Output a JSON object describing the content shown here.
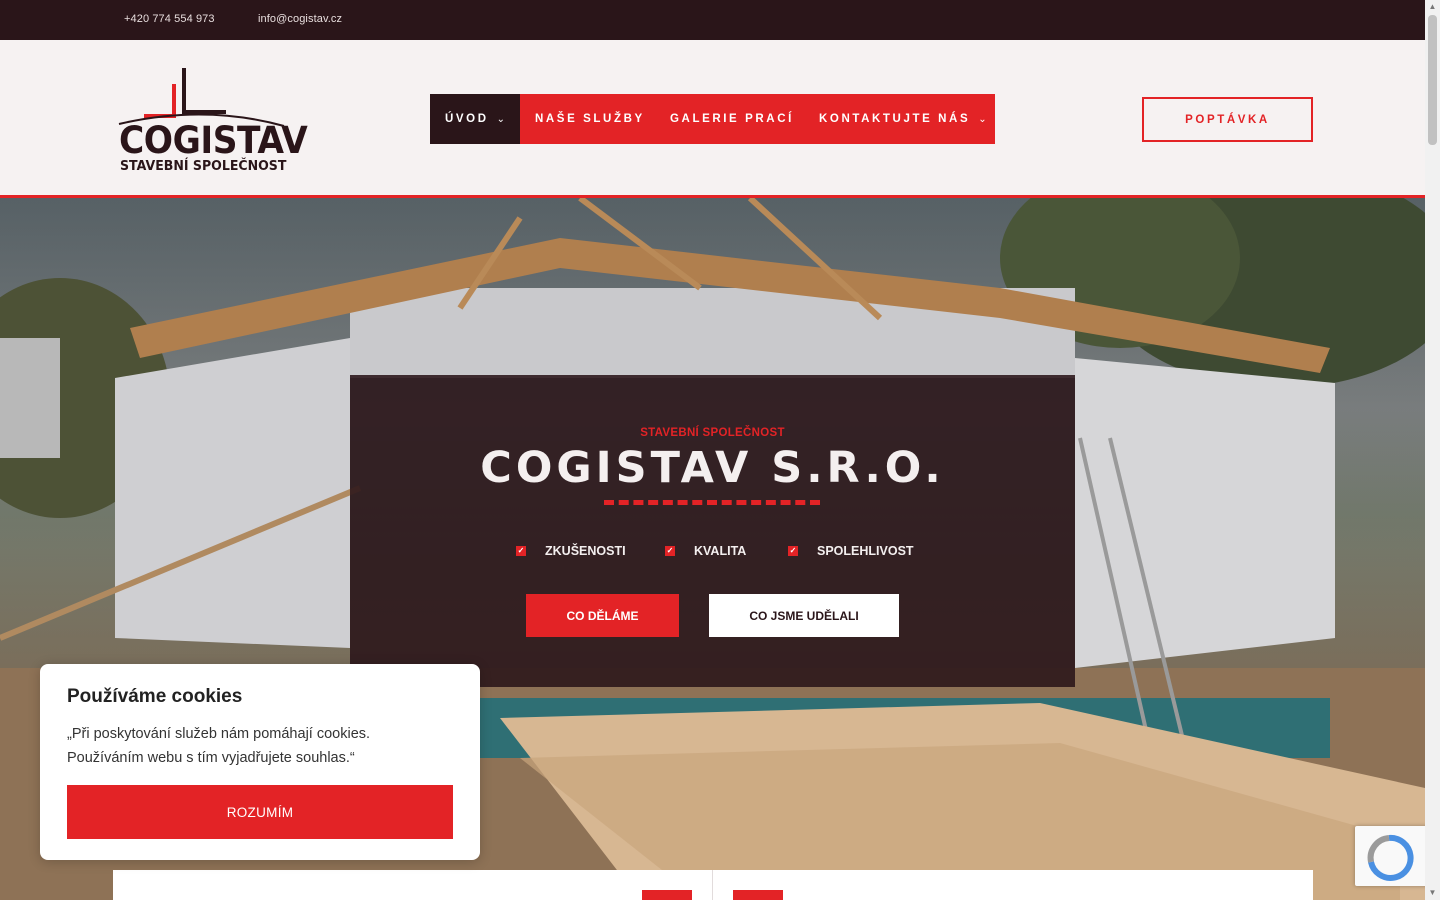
{
  "topbar": {
    "phone": "+420 774 554 973",
    "email": "info@cogistav.cz"
  },
  "brand": {
    "name": "COGISTAV",
    "tagline": "STAVEBNÍ SPOLEČNOST",
    "accent": "#e32326",
    "dark": "#2a1519"
  },
  "nav": {
    "items": [
      {
        "label": "ÚVOD",
        "has_dropdown": true,
        "active": true
      },
      {
        "label": "NAŠE SLUŽBY",
        "has_dropdown": false
      },
      {
        "label": "GALERIE PRACÍ",
        "has_dropdown": false
      },
      {
        "label": "KONTAKTUJTE NÁS",
        "has_dropdown": true
      }
    ],
    "chevron_icon": "chevron-down-icon"
  },
  "cta": {
    "poptavka": "POPTÁVKA"
  },
  "hero": {
    "kicker": "STAVEBNÍ SPOLEČNOST",
    "title": "COGISTAV S.R.O.",
    "features": [
      "ZKUŠENOSTI",
      "KVALITA",
      "SPOLEHLIVOST"
    ],
    "feature_icon": "checkbox-icon",
    "buttons": {
      "primary": "CO DĚLÁME",
      "secondary": "CO JSME UDĚLALI"
    }
  },
  "cookie": {
    "title": "Používáme cookies",
    "text": "„Při poskytování služeb nám pomáhají cookies. Používáním webu s tím vyjadřujete souhlas.“",
    "button": "ROZUMÍM"
  }
}
